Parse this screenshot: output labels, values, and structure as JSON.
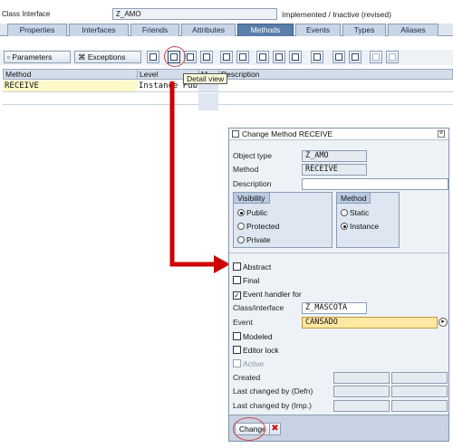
{
  "header": {
    "class_interface_label": "Class Interface",
    "class_interface_value": "Z_AMO",
    "status": "Implemented / Inactive (revised)"
  },
  "tabs": [
    "Properties",
    "Interfaces",
    "Friends",
    "Attributes",
    "Methods",
    "Events",
    "Types",
    "Aliases"
  ],
  "active_tab": "Methods",
  "toolbar": {
    "parameters_label": "Parameters",
    "exceptions_label": "Exceptions",
    "highlighted_icon": "detail-view-icon"
  },
  "table": {
    "columns": [
      "Method",
      "Level",
      "M...",
      "Description"
    ],
    "rows": [
      {
        "method": "RECEIVE",
        "level": "Instance Publ...",
        "description": ""
      }
    ]
  },
  "tooltip": "Detail view",
  "dialog": {
    "title": "Change Method RECEIVE",
    "object_type_label": "Object type",
    "object_type_value": "Z_AMO",
    "method_label": "Method",
    "method_value": "RECEIVE",
    "description_label": "Description",
    "description_value": "",
    "visibility": {
      "title": "Visibility",
      "options": [
        "Public",
        "Protected",
        "Private"
      ],
      "selected": "Public"
    },
    "method_group": {
      "title": "Method",
      "options": [
        "Static",
        "Instance"
      ],
      "selected": "Instance"
    },
    "checkboxes": {
      "abstract": "Abstract",
      "final": "Final",
      "event_handler": "Event handler for"
    },
    "class_interface_label": "Class/interface",
    "class_interface_value": "Z_MASCOTA",
    "event_label": "Event",
    "event_value": "CANSADO",
    "modeled_label": "Modeled",
    "editor_lock_label": "Editor lock",
    "active_label": "Active",
    "created_label": "Created",
    "last_changed_defn_label": "Last changed by (Defn)",
    "last_changed_imp_label": "Last changed by (Imp.)",
    "change_button": "Change"
  },
  "colors": {
    "arrow": "#cc0000",
    "active_tab": "#5a7eaa",
    "highlight_field": "#ffe8a3"
  }
}
